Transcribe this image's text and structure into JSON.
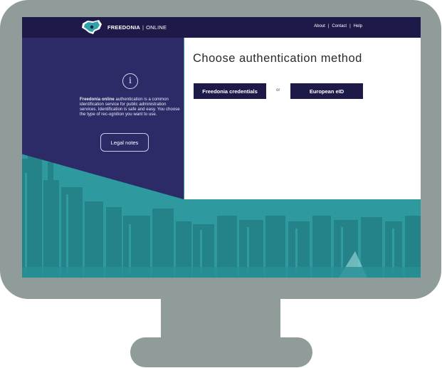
{
  "brand": {
    "name": "FREEDONIA",
    "separator": "|",
    "suffix": "ONLINE"
  },
  "nav": {
    "about": "About",
    "contact": "Contact",
    "help": "Help",
    "separator": "|"
  },
  "info": {
    "icon": "info-icon",
    "icon_glyph": "i",
    "bold_lead": "Freedonia online",
    "body": " authentication is a common identification service for public administration services. Identification is safe and easy. You choose the type of rec-ognition you want to use.",
    "legal_button": "Legal notes"
  },
  "main": {
    "title": "Choose authentication method",
    "credentials_button": "Freedonia credentials",
    "or_label": "or",
    "eid_button": "European eID"
  },
  "colors": {
    "navy": "#1d1a4a",
    "panel": "#2c2a67",
    "teal": "#2f9aa0",
    "frame": "#8f9c99"
  }
}
